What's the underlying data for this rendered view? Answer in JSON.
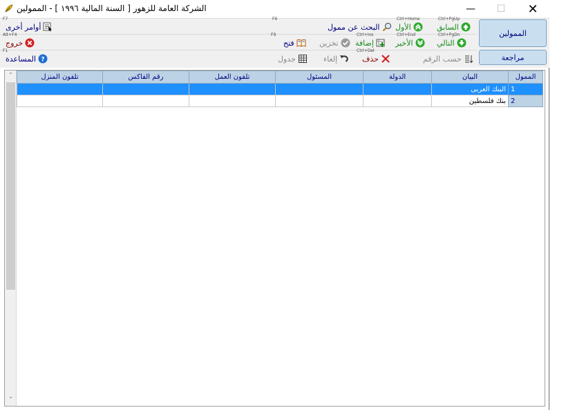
{
  "window": {
    "title": "الشركة العامة للزهور [ السنة المالية ١٩٩٦ ] - الممولين",
    "minimize": "—",
    "maximize": "☐",
    "close": "✕"
  },
  "side": {
    "funders_label": "الممولين",
    "review_label": "مراجعة"
  },
  "toolbar": {
    "prev": {
      "label": "السابق",
      "key": "Ctrl+PgUp"
    },
    "first": {
      "label": "الأول",
      "key": "Ctrl+Home"
    },
    "next": {
      "label": "التالي",
      "key": "Ctrl+PgDn"
    },
    "last": {
      "label": "الأخير",
      "key": "Ctrl+End"
    },
    "search": {
      "label": "البحث عن ممول",
      "key": "F6"
    },
    "add": {
      "label": "إضافة",
      "key": "Ctrl+Ins"
    },
    "save": {
      "label": "تخزين"
    },
    "open": {
      "label": "فتح",
      "key": "F9"
    },
    "other": {
      "label": "أوامر أخرى",
      "key": "F7"
    },
    "exit": {
      "label": "خروج",
      "key": "Alt+F4"
    },
    "help": {
      "label": "المساعدة",
      "key": "F1"
    },
    "sort": {
      "label": "حسب الرقم"
    },
    "delete": {
      "label": "حذف",
      "key": "Ctrl+Del"
    },
    "cancel": {
      "label": "إلغاء"
    },
    "table": {
      "label": "جدول"
    }
  },
  "grid": {
    "columns": [
      "الممول",
      "البيان",
      "الدولة",
      "المسئول",
      "تلفون العمل",
      "رقم الفاكس",
      "تلفون المنزل"
    ],
    "rows": [
      {
        "num": "1",
        "name": "البنك العربى",
        "selected": true
      },
      {
        "num": "2",
        "name": "بنك فلسطين",
        "selected": false
      }
    ]
  },
  "colors": {
    "accent": "#1e90ff",
    "header": "#bcd3e6",
    "side_button": "#c9dff0",
    "label_navy": "#00007f",
    "label_green": "#1a8a1a",
    "label_maroon": "#8b0000"
  },
  "icons": {
    "app": "app-feather-icon",
    "prev": "green-up-arrow-icon",
    "first": "green-double-up-arrow-icon",
    "next": "green-down-arrow-icon",
    "last": "green-double-down-arrow-icon",
    "search": "magnifier-icon",
    "add": "add-record-icon",
    "save": "grey-check-icon",
    "open": "open-book-icon",
    "other": "cursor-list-icon",
    "exit": "red-x-icon",
    "help": "blue-question-icon",
    "sort": "sort-numbers-icon",
    "delete": "red-cross-icon",
    "cancel": "undo-arrow-icon",
    "table": "grid-table-icon"
  }
}
